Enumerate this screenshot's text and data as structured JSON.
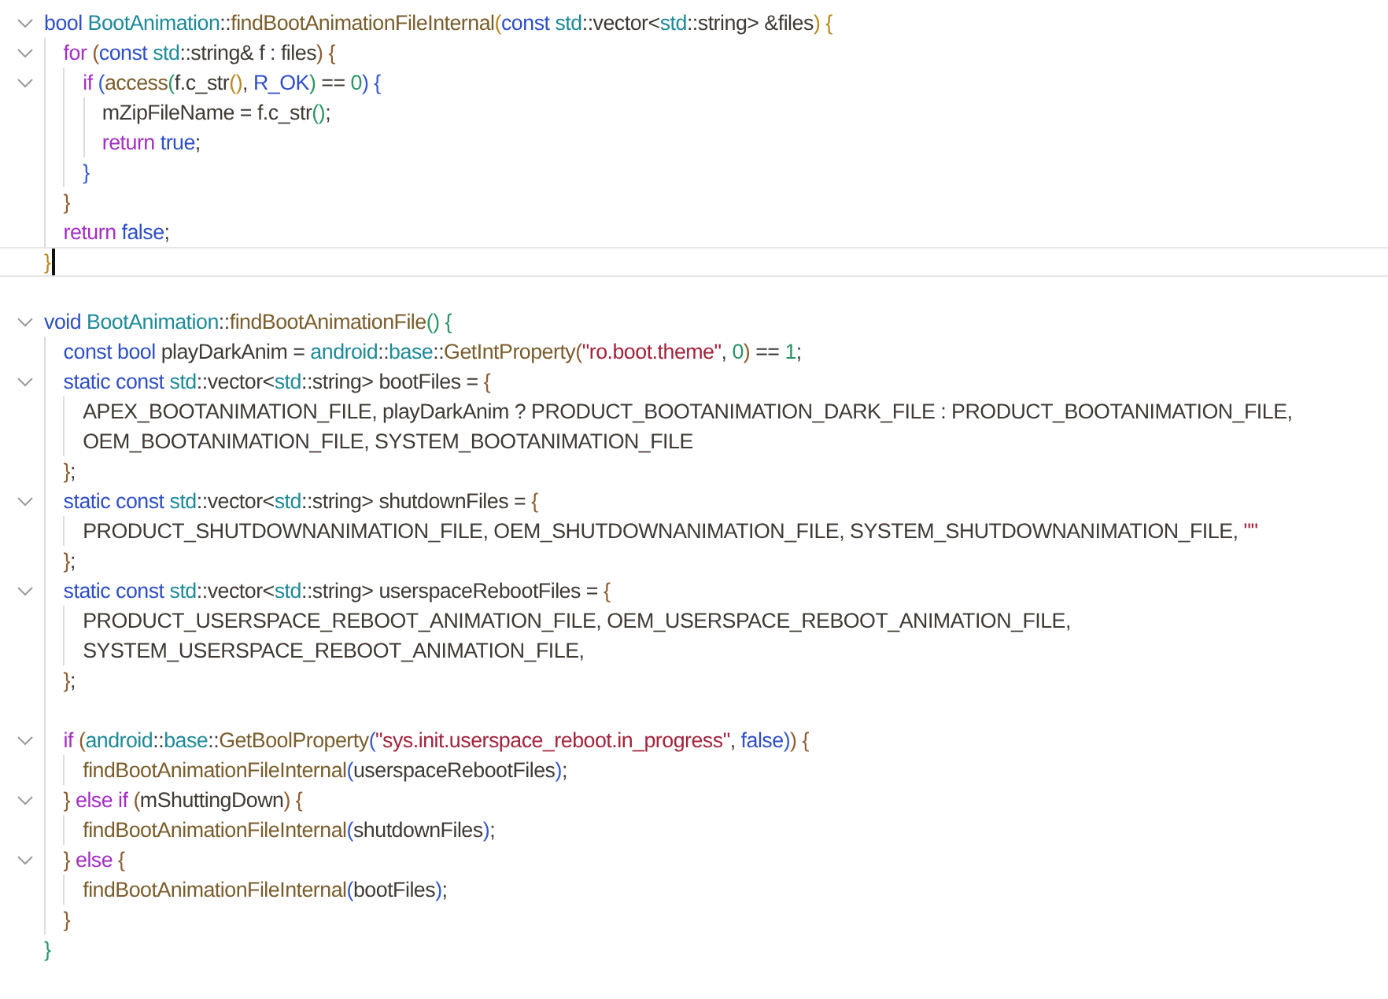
{
  "lines": [
    {
      "current": false,
      "tokens": [
        {
          "kind": "ty",
          "text": "bool "
        },
        {
          "kind": "ns",
          "text": "BootAnimation"
        },
        {
          "kind": "p",
          "text": "::"
        },
        {
          "kind": "fn",
          "text": "findBootAnimationFileInternal"
        },
        {
          "kind": "b1",
          "text": "("
        },
        {
          "kind": "ty",
          "text": "const "
        },
        {
          "kind": "ns",
          "text": "std"
        },
        {
          "kind": "p",
          "text": "::vector<"
        },
        {
          "kind": "ns",
          "text": "std"
        },
        {
          "kind": "p",
          "text": "::string> &files"
        },
        {
          "kind": "b1",
          "text": ") "
        },
        {
          "kind": "b1",
          "text": "{"
        }
      ],
      "children": [
        {
          "current": false,
          "tokens": [
            {
              "kind": "kw",
              "text": "for "
            },
            {
              "kind": "b2",
              "text": "("
            },
            {
              "kind": "ty",
              "text": "const "
            },
            {
              "kind": "ns",
              "text": "std"
            },
            {
              "kind": "p",
              "text": "::string& f : files"
            },
            {
              "kind": "b2",
              "text": ") {"
            }
          ],
          "children": [
            {
              "current": false,
              "tokens": [
                {
                  "kind": "kw",
                  "text": "if "
                },
                {
                  "kind": "b3",
                  "text": "("
                },
                {
                  "kind": "fn",
                  "text": "access"
                },
                {
                  "kind": "b4",
                  "text": "("
                },
                {
                  "kind": "p",
                  "text": "f.c_str"
                },
                {
                  "kind": "b1",
                  "text": "()"
                },
                {
                  "kind": "p",
                  "text": ", "
                },
                {
                  "kind": "ty",
                  "text": "R_OK"
                },
                {
                  "kind": "b4",
                  "text": ")"
                },
                {
                  "kind": "p",
                  "text": " == "
                },
                {
                  "kind": "num",
                  "text": "0"
                },
                {
                  "kind": "b3",
                  "text": ") {"
                }
              ],
              "children": [
                {
                  "current": false,
                  "tokens": [
                    {
                      "kind": "p",
                      "text": "mZipFileName = f.c_str"
                    },
                    {
                      "kind": "b4",
                      "text": "()"
                    },
                    {
                      "kind": "p",
                      "text": ";"
                    }
                  ]
                },
                {
                  "current": false,
                  "tokens": [
                    {
                      "kind": "kw",
                      "text": "return "
                    },
                    {
                      "kind": "ty",
                      "text": "true"
                    },
                    {
                      "kind": "p",
                      "text": ";"
                    }
                  ]
                }
              ]
            },
            {
              "current": false,
              "tokens": [
                {
                  "kind": "b3",
                  "text": "}"
                }
              ]
            }
          ]
        },
        {
          "current": false,
          "tokens": [
            {
              "kind": "b2",
              "text": "}"
            }
          ]
        },
        {
          "current": false,
          "tokens": [
            {
              "kind": "kw",
              "text": "return "
            },
            {
              "kind": "ty",
              "text": "false"
            },
            {
              "kind": "p",
              "text": ";"
            }
          ]
        }
      ]
    },
    {
      "current": true,
      "tokens": [
        {
          "kind": "b1",
          "text": "}"
        }
      ]
    },
    {
      "current": false
    },
    {
      "current": false,
      "tokens": [
        {
          "kind": "ty",
          "text": "void "
        },
        {
          "kind": "ns",
          "text": "BootAnimation"
        },
        {
          "kind": "p",
          "text": "::"
        },
        {
          "kind": "fn",
          "text": "findBootAnimationFile"
        },
        {
          "kind": "b4",
          "text": "() {"
        }
      ],
      "children": [
        {
          "current": false,
          "tokens": [
            {
              "kind": "ty",
              "text": "const bool"
            },
            {
              "kind": "p",
              "text": " playDarkAnim = "
            },
            {
              "kind": "ns",
              "text": "android"
            },
            {
              "kind": "p",
              "text": "::"
            },
            {
              "kind": "ns",
              "text": "base"
            },
            {
              "kind": "p",
              "text": "::"
            },
            {
              "kind": "fn",
              "text": "GetIntProperty"
            },
            {
              "kind": "b2",
              "text": "("
            },
            {
              "kind": "str",
              "text": "\"ro.boot.theme\""
            },
            {
              "kind": "p",
              "text": ", "
            },
            {
              "kind": "num",
              "text": "0"
            },
            {
              "kind": "b2",
              "text": ")"
            },
            {
              "kind": "p",
              "text": " == "
            },
            {
              "kind": "num",
              "text": "1"
            },
            {
              "kind": "p",
              "text": ";"
            }
          ]
        },
        {
          "current": false,
          "tokens": [
            {
              "kind": "ty",
              "text": "static const "
            },
            {
              "kind": "ns",
              "text": "std"
            },
            {
              "kind": "p",
              "text": "::vector<"
            },
            {
              "kind": "ns",
              "text": "std"
            },
            {
              "kind": "p",
              "text": "::string> bootFiles = "
            },
            {
              "kind": "b2",
              "text": "{"
            }
          ],
          "children": [
            {
              "current": false,
              "tokens": [
                {
                  "kind": "p",
                  "text": "APEX_BOOTANIMATION_FILE, playDarkAnim ? PRODUCT_BOOTANIMATION_DARK_FILE : PRODUCT_BOOTANIMATION_FILE,"
                }
              ]
            },
            {
              "current": false,
              "tokens": [
                {
                  "kind": "p",
                  "text": "OEM_BOOTANIMATION_FILE, SYSTEM_BOOTANIMATION_FILE"
                }
              ]
            }
          ]
        },
        {
          "current": false,
          "tokens": [
            {
              "kind": "b2",
              "text": "}"
            },
            {
              "kind": "p",
              "text": ";"
            }
          ]
        },
        {
          "current": false,
          "tokens": [
            {
              "kind": "ty",
              "text": "static const "
            },
            {
              "kind": "ns",
              "text": "std"
            },
            {
              "kind": "p",
              "text": "::vector<"
            },
            {
              "kind": "ns",
              "text": "std"
            },
            {
              "kind": "p",
              "text": "::string> shutdownFiles = "
            },
            {
              "kind": "b2",
              "text": "{"
            }
          ],
          "children": [
            {
              "current": false,
              "tokens": [
                {
                  "kind": "p",
                  "text": "PRODUCT_SHUTDOWNANIMATION_FILE, OEM_SHUTDOWNANIMATION_FILE, SYSTEM_SHUTDOWNANIMATION_FILE, "
                },
                {
                  "kind": "str",
                  "text": "\"\""
                }
              ]
            }
          ]
        },
        {
          "current": false,
          "tokens": [
            {
              "kind": "b2",
              "text": "}"
            },
            {
              "kind": "p",
              "text": ";"
            }
          ]
        },
        {
          "current": false,
          "tokens": [
            {
              "kind": "ty",
              "text": "static const "
            },
            {
              "kind": "ns",
              "text": "std"
            },
            {
              "kind": "p",
              "text": "::vector<"
            },
            {
              "kind": "ns",
              "text": "std"
            },
            {
              "kind": "p",
              "text": "::string> userspaceRebootFiles = "
            },
            {
              "kind": "b2",
              "text": "{"
            }
          ],
          "children": [
            {
              "current": false,
              "tokens": [
                {
                  "kind": "p",
                  "text": "PRODUCT_USERSPACE_REBOOT_ANIMATION_FILE, OEM_USERSPACE_REBOOT_ANIMATION_FILE,"
                }
              ]
            },
            {
              "current": false,
              "tokens": [
                {
                  "kind": "p",
                  "text": "SYSTEM_USERSPACE_REBOOT_ANIMATION_FILE,"
                }
              ]
            }
          ]
        },
        {
          "current": false,
          "tokens": [
            {
              "kind": "b2",
              "text": "}"
            },
            {
              "kind": "p",
              "text": ";"
            }
          ]
        },
        {
          "current": false
        },
        {
          "current": false,
          "tokens": [
            {
              "kind": "kw",
              "text": "if "
            },
            {
              "kind": "b2",
              "text": "("
            },
            {
              "kind": "ns",
              "text": "android"
            },
            {
              "kind": "p",
              "text": "::"
            },
            {
              "kind": "ns",
              "text": "base"
            },
            {
              "kind": "p",
              "text": "::"
            },
            {
              "kind": "fn",
              "text": "GetBoolProperty"
            },
            {
              "kind": "b3",
              "text": "("
            },
            {
              "kind": "str",
              "text": "\"sys.init.userspace_reboot.in_progress\""
            },
            {
              "kind": "p",
              "text": ", "
            },
            {
              "kind": "ty",
              "text": "false"
            },
            {
              "kind": "b3",
              "text": ")"
            },
            {
              "kind": "b2",
              "text": ") {"
            }
          ],
          "children": [
            {
              "current": false,
              "tokens": [
                {
                  "kind": "fn",
                  "text": "findBootAnimationFileInternal"
                },
                {
                  "kind": "b3",
                  "text": "("
                },
                {
                  "kind": "p",
                  "text": "userspaceRebootFiles"
                },
                {
                  "kind": "b3",
                  "text": ")"
                },
                {
                  "kind": "p",
                  "text": ";"
                }
              ]
            }
          ]
        },
        {
          "current": false,
          "tokens": [
            {
              "kind": "b2",
              "text": "} "
            },
            {
              "kind": "kw",
              "text": "else if "
            },
            {
              "kind": "b2",
              "text": "("
            },
            {
              "kind": "p",
              "text": "mShuttingDown"
            },
            {
              "kind": "b2",
              "text": ") {"
            }
          ],
          "children": [
            {
              "current": false,
              "tokens": [
                {
                  "kind": "fn",
                  "text": "findBootAnimationFileInternal"
                },
                {
                  "kind": "b3",
                  "text": "("
                },
                {
                  "kind": "p",
                  "text": "shutdownFiles"
                },
                {
                  "kind": "b3",
                  "text": ")"
                },
                {
                  "kind": "p",
                  "text": ";"
                }
              ]
            }
          ]
        },
        {
          "current": false,
          "tokens": [
            {
              "kind": "b2",
              "text": "} "
            },
            {
              "kind": "kw",
              "text": "else "
            },
            {
              "kind": "b2",
              "text": "{"
            }
          ],
          "children": [
            {
              "current": false,
              "tokens": [
                {
                  "kind": "fn",
                  "text": "findBootAnimationFileInternal"
                },
                {
                  "kind": "b3",
                  "text": "("
                },
                {
                  "kind": "p",
                  "text": "bootFiles"
                },
                {
                  "kind": "b3",
                  "text": ")"
                },
                {
                  "kind": "p",
                  "text": ";"
                }
              ]
            }
          ]
        },
        {
          "current": false,
          "tokens": [
            {
              "kind": "b2",
              "text": "}"
            }
          ]
        }
      ]
    },
    {
      "current": false,
      "tokens": [
        {
          "kind": "b4",
          "text": "}"
        }
      ]
    }
  ]
}
